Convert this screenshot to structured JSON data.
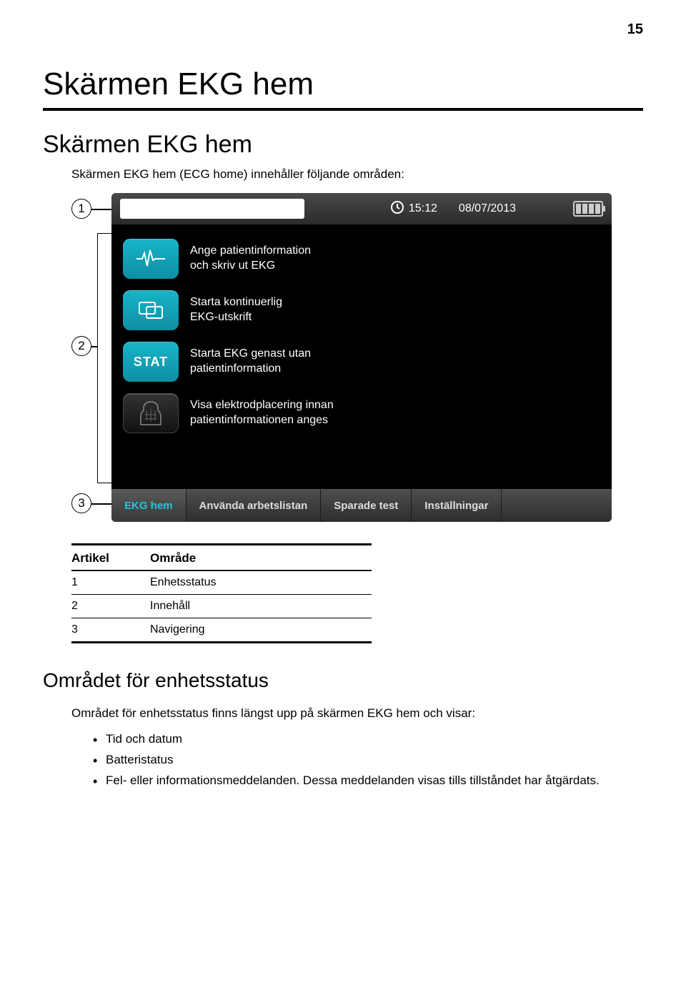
{
  "page_number": "15",
  "chapter_title": "Skärmen EKG hem",
  "section_title": "Skärmen EKG hem",
  "intro": "Skärmen EKG hem (ECG home) innehåller följande områden:",
  "callouts": {
    "c1": "1",
    "c2": "2",
    "c3": "3"
  },
  "statusbar": {
    "time": "15:12",
    "date": "08/07/2013"
  },
  "menu": {
    "item1_line1": "Ange patientinformation",
    "item1_line2": "och skriv ut EKG",
    "item2_line1": "Starta kontinuerlig",
    "item2_line2": "EKG-utskrift",
    "item3_label": "STAT",
    "item3_line1": "Starta EKG genast utan",
    "item3_line2": "patientinformation",
    "item4_line1": "Visa elektrodplacering innan",
    "item4_line2": "patientinformationen anges"
  },
  "tabs": {
    "t1": "EKG hem",
    "t2": "Använda arbetslistan",
    "t3": "Sparade test",
    "t4": "Inställningar"
  },
  "table": {
    "head_col1": "Artikel",
    "head_col2": "Område",
    "rows": [
      {
        "n": "1",
        "label": "Enhetsstatus"
      },
      {
        "n": "2",
        "label": "Innehåll"
      },
      {
        "n": "3",
        "label": "Navigering"
      }
    ]
  },
  "h3": "Området för enhetsstatus",
  "para2": "Området för enhetsstatus finns längst upp på skärmen EKG hem och visar:",
  "bullets": {
    "b1": "Tid och datum",
    "b2": "Batteristatus",
    "b3": "Fel- eller informationsmeddelanden. Dessa meddelanden visas tills tillståndet har åtgärdats."
  }
}
